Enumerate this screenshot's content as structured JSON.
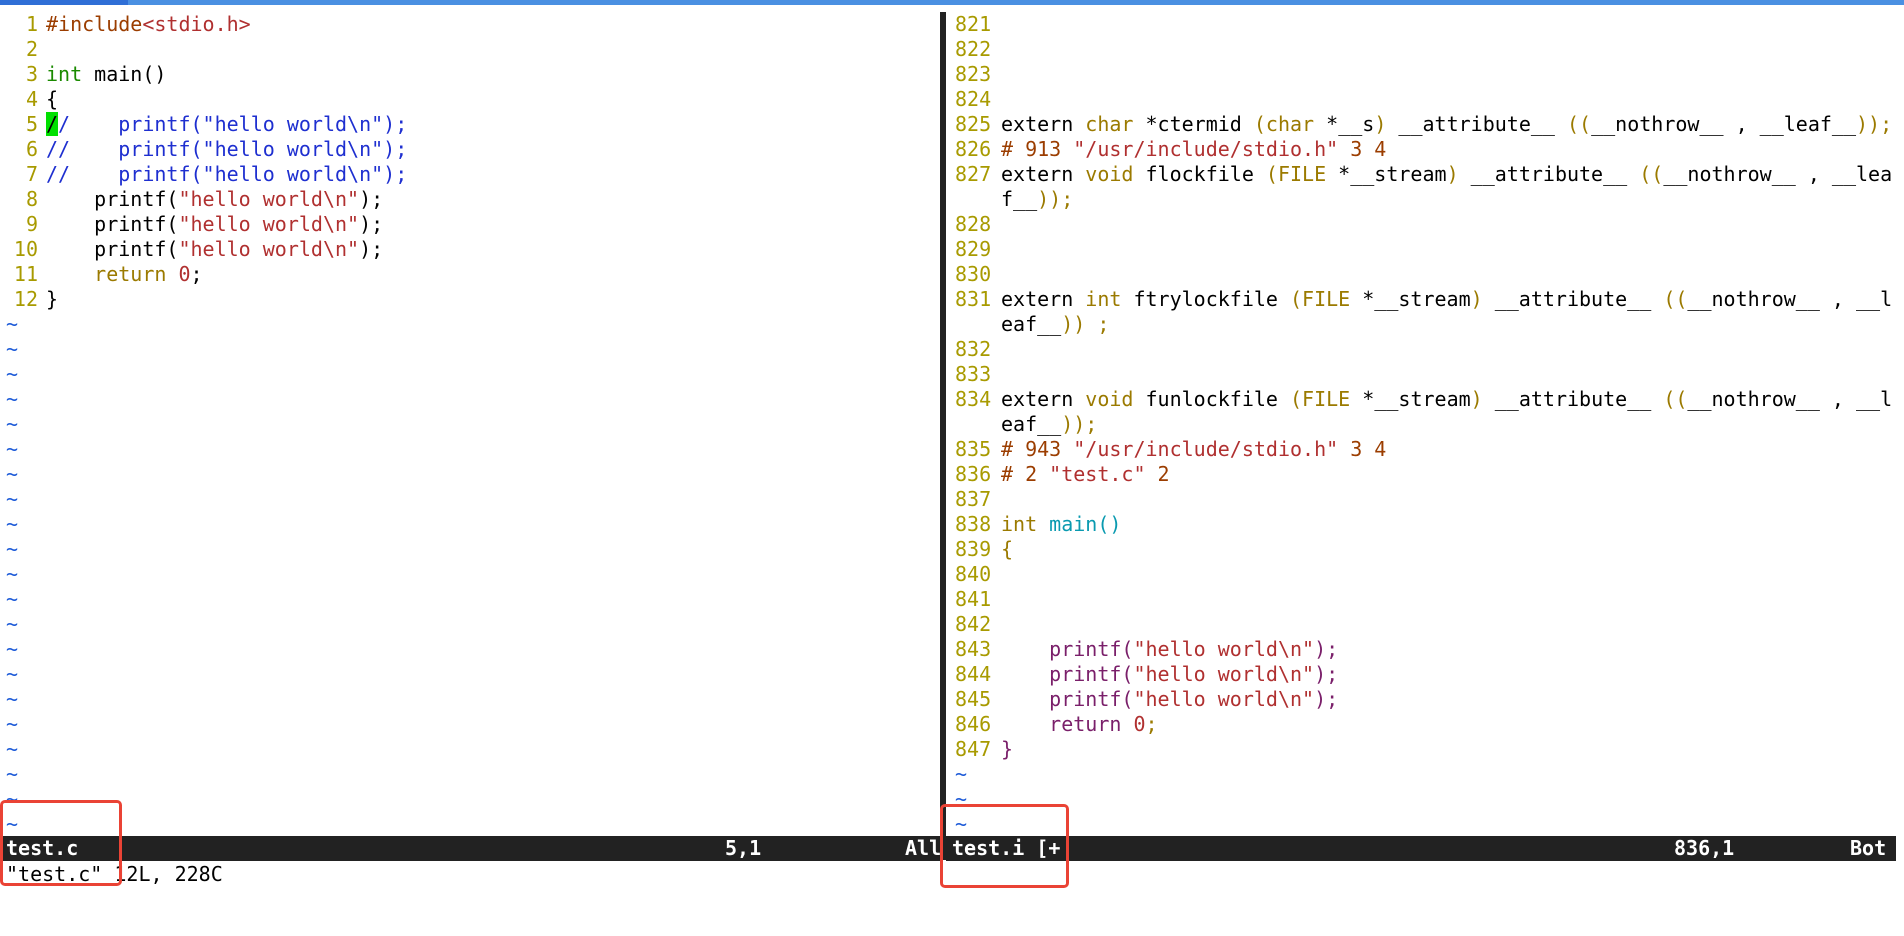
{
  "left_pane": {
    "filename": "test.c",
    "lines": [
      {
        "n": "1",
        "parts": [
          {
            "t": "#include",
            "c": "pp"
          },
          {
            "t": "<stdio.h>",
            "c": "str"
          }
        ]
      },
      {
        "n": "2",
        "parts": []
      },
      {
        "n": "3",
        "parts": [
          {
            "t": "int",
            "c": "kw"
          },
          {
            "t": " main()",
            "c": "fn"
          }
        ]
      },
      {
        "n": "4",
        "parts": [
          {
            "t": "{",
            "c": "fn"
          }
        ]
      },
      {
        "n": "5",
        "parts": [
          {
            "t": "/",
            "c": "cursor"
          },
          {
            "t": "/    printf(\"hello world\\n\");",
            "c": "cm"
          }
        ]
      },
      {
        "n": "6",
        "parts": [
          {
            "t": "//    printf(\"hello world\\n\");",
            "c": "cm"
          }
        ]
      },
      {
        "n": "7",
        "parts": [
          {
            "t": "//    printf(\"hello world\\n\");",
            "c": "cm"
          }
        ]
      },
      {
        "n": "8",
        "parts": [
          {
            "t": "    printf(",
            "c": "fn"
          },
          {
            "t": "\"hello world\\n\"",
            "c": "str"
          },
          {
            "t": ");",
            "c": "fn"
          }
        ]
      },
      {
        "n": "9",
        "parts": [
          {
            "t": "    printf(",
            "c": "fn"
          },
          {
            "t": "\"hello world\\n\"",
            "c": "str"
          },
          {
            "t": ");",
            "c": "fn"
          }
        ]
      },
      {
        "n": "10",
        "parts": [
          {
            "t": "    printf(",
            "c": "fn"
          },
          {
            "t": "\"hello world\\n\"",
            "c": "str"
          },
          {
            "t": ");",
            "c": "fn"
          }
        ]
      },
      {
        "n": "11",
        "parts": [
          {
            "t": "    return",
            "c": "ret"
          },
          {
            "t": " ",
            "c": "fn"
          },
          {
            "t": "0",
            "c": "num"
          },
          {
            "t": ";",
            "c": "fn"
          }
        ]
      },
      {
        "n": "12",
        "parts": [
          {
            "t": "}",
            "c": "fn"
          }
        ]
      }
    ],
    "tilde_count": 21
  },
  "right_pane": {
    "filename": "test.i [+",
    "lines": [
      {
        "n": "821",
        "parts": []
      },
      {
        "n": "822",
        "parts": []
      },
      {
        "n": "823",
        "parts": []
      },
      {
        "n": "824",
        "parts": []
      },
      {
        "n": "825",
        "parts": [
          {
            "t": "extern ",
            "c": "fn"
          },
          {
            "t": "char",
            "c": "type"
          },
          {
            "t": " *ctermid ",
            "c": "fn"
          },
          {
            "t": "(char",
            "c": "type"
          },
          {
            "t": " *__s",
            "c": "fn"
          },
          {
            "t": ")",
            "c": "type"
          },
          {
            "t": " __attribute__ ",
            "c": "fn"
          },
          {
            "t": "((",
            "c": "type"
          },
          {
            "t": "__nothrow__ , __leaf__",
            "c": "fn"
          },
          {
            "t": "));",
            "c": "type"
          }
        ]
      },
      {
        "n": "826",
        "parts": [
          {
            "t": "# 913 ",
            "c": "pp"
          },
          {
            "t": "\"/usr/include/stdio.h\"",
            "c": "str"
          },
          {
            "t": " 3 4",
            "c": "pp"
          }
        ]
      },
      {
        "n": "827",
        "parts": [
          {
            "t": "extern ",
            "c": "fn"
          },
          {
            "t": "void",
            "c": "type"
          },
          {
            "t": " flockfile ",
            "c": "fn"
          },
          {
            "t": "(FILE",
            "c": "type"
          },
          {
            "t": " *__stream",
            "c": "fn"
          },
          {
            "t": ")",
            "c": "type"
          },
          {
            "t": " __attribute__ ",
            "c": "fn"
          },
          {
            "t": "((",
            "c": "type"
          },
          {
            "t": "__nothrow__ , __lea",
            "c": "fn"
          }
        ]
      },
      {
        "n": "",
        "parts": [
          {
            "t": "f__",
            "c": "fn"
          },
          {
            "t": "));",
            "c": "type"
          }
        ]
      },
      {
        "n": "828",
        "parts": []
      },
      {
        "n": "829",
        "parts": []
      },
      {
        "n": "830",
        "parts": []
      },
      {
        "n": "831",
        "parts": [
          {
            "t": "extern ",
            "c": "fn"
          },
          {
            "t": "int",
            "c": "type"
          },
          {
            "t": " ftrylockfile ",
            "c": "fn"
          },
          {
            "t": "(FILE",
            "c": "type"
          },
          {
            "t": " *__stream",
            "c": "fn"
          },
          {
            "t": ")",
            "c": "type"
          },
          {
            "t": " __attribute__ ",
            "c": "fn"
          },
          {
            "t": "((",
            "c": "type"
          },
          {
            "t": "__nothrow__ , __l",
            "c": "fn"
          }
        ]
      },
      {
        "n": "",
        "parts": [
          {
            "t": "eaf__",
            "c": "fn"
          },
          {
            "t": ")) ;",
            "c": "type"
          }
        ]
      },
      {
        "n": "832",
        "parts": []
      },
      {
        "n": "833",
        "parts": []
      },
      {
        "n": "834",
        "parts": [
          {
            "t": "extern ",
            "c": "fn"
          },
          {
            "t": "void",
            "c": "type"
          },
          {
            "t": " funlockfile ",
            "c": "fn"
          },
          {
            "t": "(FILE",
            "c": "type"
          },
          {
            "t": " *__stream",
            "c": "fn"
          },
          {
            "t": ")",
            "c": "type"
          },
          {
            "t": " __attribute__ ",
            "c": "fn"
          },
          {
            "t": "((",
            "c": "type"
          },
          {
            "t": "__nothrow__ , __l",
            "c": "fn"
          }
        ]
      },
      {
        "n": "",
        "parts": [
          {
            "t": "eaf__",
            "c": "fn"
          },
          {
            "t": "));",
            "c": "type"
          }
        ]
      },
      {
        "n": "835",
        "parts": [
          {
            "t": "# 943 ",
            "c": "pp"
          },
          {
            "t": "\"/usr/include/stdio.h\"",
            "c": "str"
          },
          {
            "t": " 3 4",
            "c": "pp"
          }
        ]
      },
      {
        "n": "836",
        "parts": [
          {
            "t": "# 2 ",
            "c": "pp"
          },
          {
            "t": "\"test.c\"",
            "c": "str"
          },
          {
            "t": " 2",
            "c": "pp"
          }
        ]
      },
      {
        "n": "837",
        "parts": []
      },
      {
        "n": "838",
        "parts": [
          {
            "t": "int",
            "c": "type"
          },
          {
            "t": " main()",
            "c": "kw2"
          }
        ]
      },
      {
        "n": "839",
        "parts": [
          {
            "t": "{",
            "c": "type"
          }
        ]
      },
      {
        "n": "840",
        "parts": []
      },
      {
        "n": "841",
        "parts": []
      },
      {
        "n": "842",
        "parts": []
      },
      {
        "n": "843",
        "parts": [
          {
            "t": "    printf(",
            "c": "fn2"
          },
          {
            "t": "\"hello world\\n\"",
            "c": "str"
          },
          {
            "t": ");",
            "c": "fn2"
          }
        ]
      },
      {
        "n": "844",
        "parts": [
          {
            "t": "    printf(",
            "c": "fn2"
          },
          {
            "t": "\"hello world\\n\"",
            "c": "str"
          },
          {
            "t": ");",
            "c": "fn2"
          }
        ]
      },
      {
        "n": "845",
        "parts": [
          {
            "t": "    printf(",
            "c": "fn2"
          },
          {
            "t": "\"hello world\\n\"",
            "c": "str"
          },
          {
            "t": ");",
            "c": "fn2"
          }
        ]
      },
      {
        "n": "846",
        "parts": [
          {
            "t": "    return ",
            "c": "fn2"
          },
          {
            "t": "0",
            "c": "num"
          },
          {
            "t": ";",
            "c": "type"
          }
        ]
      },
      {
        "n": "847",
        "parts": [
          {
            "t": "}",
            "c": "fn2"
          }
        ]
      }
    ],
    "tilde_count": 3
  },
  "status_left": {
    "name": "test.c",
    "pos": "5,1",
    "pct": "All"
  },
  "status_right": {
    "name": "test.i [+",
    "pos": "836,1",
    "pct": "Bot"
  },
  "cmdline": "\"test.c\" 12L, 228C",
  "tilde_char": "~",
  "colors": {
    "status_bg": "#222222",
    "highlight_box": "#ea4335",
    "line_number": "#a89a00",
    "tilde": "#1e5bd8",
    "cursor": "#00e000"
  }
}
